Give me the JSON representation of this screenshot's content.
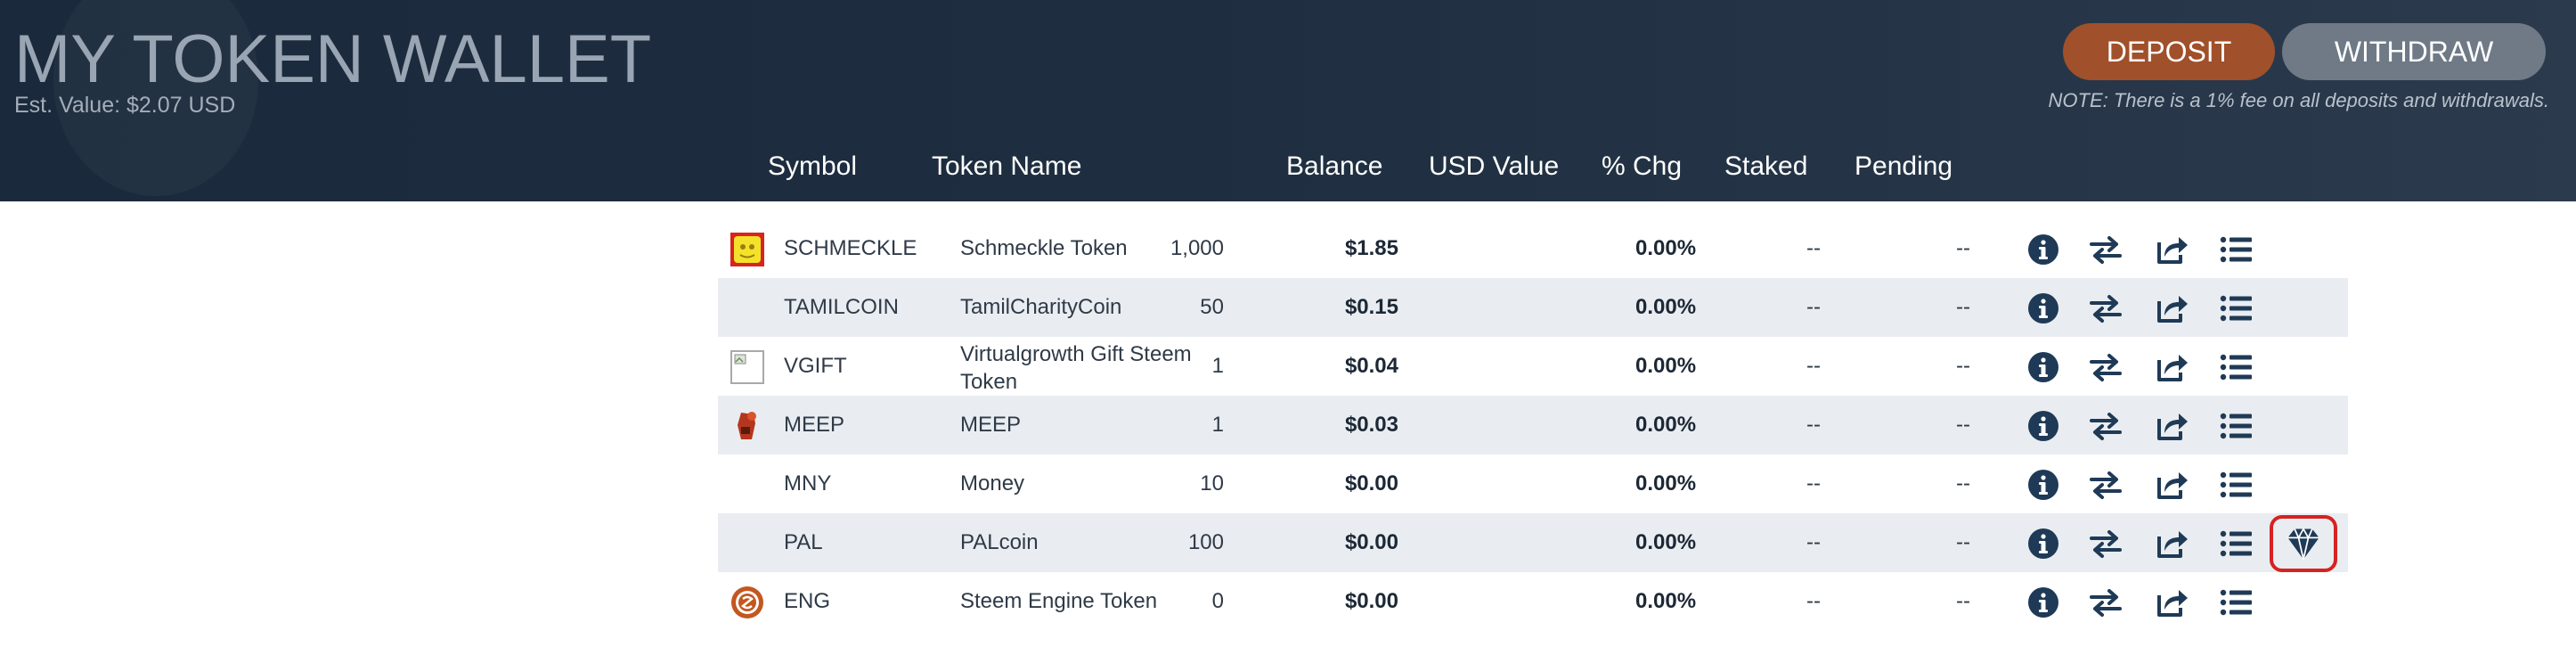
{
  "header": {
    "title": "MY TOKEN WALLET",
    "est_value": "Est. Value: $2.07 USD",
    "deposit_label": "DEPOSIT",
    "withdraw_label": "WITHDRAW",
    "fee_note": "NOTE: There is a 1% fee on all deposits and withdrawals."
  },
  "columns": {
    "symbol": "Symbol",
    "token_name": "Token Name",
    "balance": "Balance",
    "usd_value": "USD Value",
    "pct_chg": "% Chg",
    "staked": "Staked",
    "pending": "Pending"
  },
  "rows": [
    {
      "symbol": "SCHMECKLE",
      "name": "Schmeckle Token",
      "balance": "1,000",
      "usd": "$1.85",
      "chg": "0.00%",
      "staked": "--",
      "pending": "--",
      "icon": "schmeckle-icon"
    },
    {
      "symbol": "TAMILCOIN",
      "name": "TamilCharityCoin",
      "balance": "50",
      "usd": "$0.15",
      "chg": "0.00%",
      "staked": "--",
      "pending": "--",
      "icon": "none"
    },
    {
      "symbol": "VGIFT",
      "name": "Virtualgrowth Gift Steem Token",
      "balance": "1",
      "usd": "$0.04",
      "chg": "0.00%",
      "staked": "--",
      "pending": "--",
      "icon": "broken-image-icon"
    },
    {
      "symbol": "MEEP",
      "name": "MEEP",
      "balance": "1",
      "usd": "$0.03",
      "chg": "0.00%",
      "staked": "--",
      "pending": "--",
      "icon": "meep-icon"
    },
    {
      "symbol": "MNY",
      "name": "Money",
      "balance": "10",
      "usd": "$0.00",
      "chg": "0.00%",
      "staked": "--",
      "pending": "--",
      "icon": "none"
    },
    {
      "symbol": "PAL",
      "name": "PALcoin",
      "balance": "100",
      "usd": "$0.00",
      "chg": "0.00%",
      "staked": "--",
      "pending": "--",
      "icon": "none"
    },
    {
      "symbol": "ENG",
      "name": "Steem Engine Token",
      "balance": "0",
      "usd": "$0.00",
      "chg": "0.00%",
      "staked": "--",
      "pending": "--",
      "icon": "eng-icon"
    }
  ],
  "colors": {
    "header_bg": "#1e2e40",
    "deposit": "#a0502a",
    "withdraw": "#6f7a86",
    "action_icon": "#1f3a56",
    "highlight": "#d62222"
  }
}
